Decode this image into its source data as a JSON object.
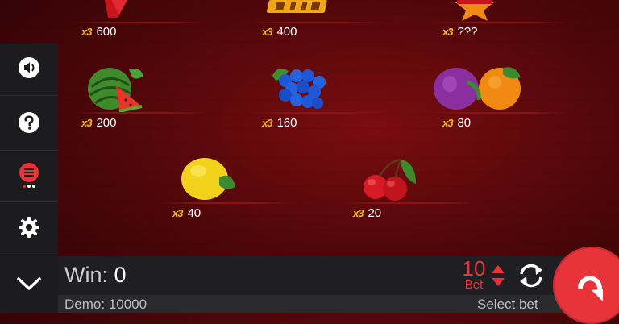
{
  "paytable": {
    "row1": [
      {
        "symbol": "seven",
        "value": "600"
      },
      {
        "symbol": "wild",
        "value": "400"
      },
      {
        "symbol": "star",
        "value": "???"
      }
    ],
    "row2": [
      {
        "symbol": "watermelon",
        "value": "200"
      },
      {
        "symbol": "grapes",
        "value": "160"
      },
      {
        "symbol": "plum-orange",
        "value": "80"
      }
    ],
    "row3": [
      {
        "symbol": "lemon",
        "value": "40"
      },
      {
        "symbol": "cherries",
        "value": "20"
      }
    ],
    "multiplier_label": "x3"
  },
  "sidebar": {
    "items": [
      "sound-icon",
      "help-icon",
      "paytable-icon",
      "settings-icon",
      "collapse-icon"
    ]
  },
  "bottom": {
    "win_label": "Win:",
    "win_value": "0",
    "bet_value": "10",
    "bet_label": "Bet",
    "demo_label": "Demo:",
    "demo_value": "10000",
    "select_bet_label": "Select bet"
  },
  "colors": {
    "accent": "#e8333a",
    "gold": "#f2b417",
    "sidebar": "#1c1c1f"
  }
}
